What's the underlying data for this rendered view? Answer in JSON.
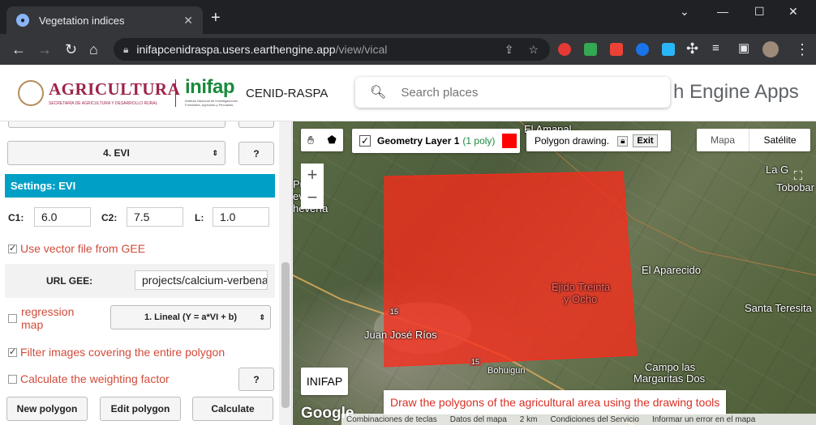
{
  "browser": {
    "tab_title": "Vegetation indices",
    "new_tab": "+",
    "url_domain": "inifapcenidraspa.users.earthengine.app",
    "url_path": "/view/vical"
  },
  "header": {
    "agri_name": "AGRICULTURA",
    "agri_sub": "SECRETARÍA DE AGRICULTURA Y DESARROLLO RURAL",
    "inifap_logo": "inifap",
    "inifap_sub": "Instituto Nacional de Investigaciones Forestales, Agrícolas y Pecuarias",
    "cenid": "CENID-RASPA",
    "search_placeholder": "Search places",
    "ee_apps": "h Engine Apps"
  },
  "panel": {
    "index_select": "4. EVI",
    "help_label": "?",
    "settings_title": "Settings: EVI",
    "c1_label": "C1:",
    "c1_value": "6.0",
    "c2_label": "C2:",
    "c2_value": "7.5",
    "l_label": "L:",
    "l_value": "1.0",
    "vector_label": "Use vector file from GEE",
    "url_label": "URL GEE:",
    "url_value": "projects/calcium-verbena",
    "regression_label_1": "regression",
    "regression_label_2": "map",
    "regression_select": "1. Lineal (Y = a*VI + b)",
    "filter_label": "Filter images covering the entire polygon",
    "weighting_label": "Calculate the weighting factor",
    "new_polygon": "New polygon",
    "edit_polygon": "Edit polygon",
    "calculate": "Calculate"
  },
  "map": {
    "layer_name": "Geometry Layer 1",
    "layer_count": "(1 poly)",
    "layer_color": "#ff0000",
    "polygon_drawing": "Polygon drawing.",
    "exit": "Exit",
    "map_type_map": "Mapa",
    "map_type_sat": "Satélite",
    "zoom_in": "+",
    "zoom_out": "−",
    "inifap_button": "INIFAP",
    "hint": "Draw the polygons of the agricultural area using the drawing tools",
    "google": "Google",
    "places": {
      "el_amapal": "El Amapal",
      "la_g": "La G",
      "tobobar": "Tobobar",
      "el_aparecido": "El Aparecido",
      "ejido_1": "Ejido Treinta",
      "ejido_2": "y Ocho",
      "santa_teresita": "Santa Teresita",
      "juan_jose_rios": "Juan José Ríos",
      "campo_1": "Campo las",
      "campo_2": "Margaritas Dos",
      "left_1": "Pu",
      "left_2": "ev... is",
      "left_3": "hevería",
      "road_15a": "15",
      "road_15b": "15",
      "bohuiguri": "Bohuiguri"
    },
    "attribution": [
      "Combinaciones de teclas",
      "Datos del mapa",
      "2 km",
      "Condiciones del Servicio",
      "Informar un error en el mapa"
    ]
  }
}
